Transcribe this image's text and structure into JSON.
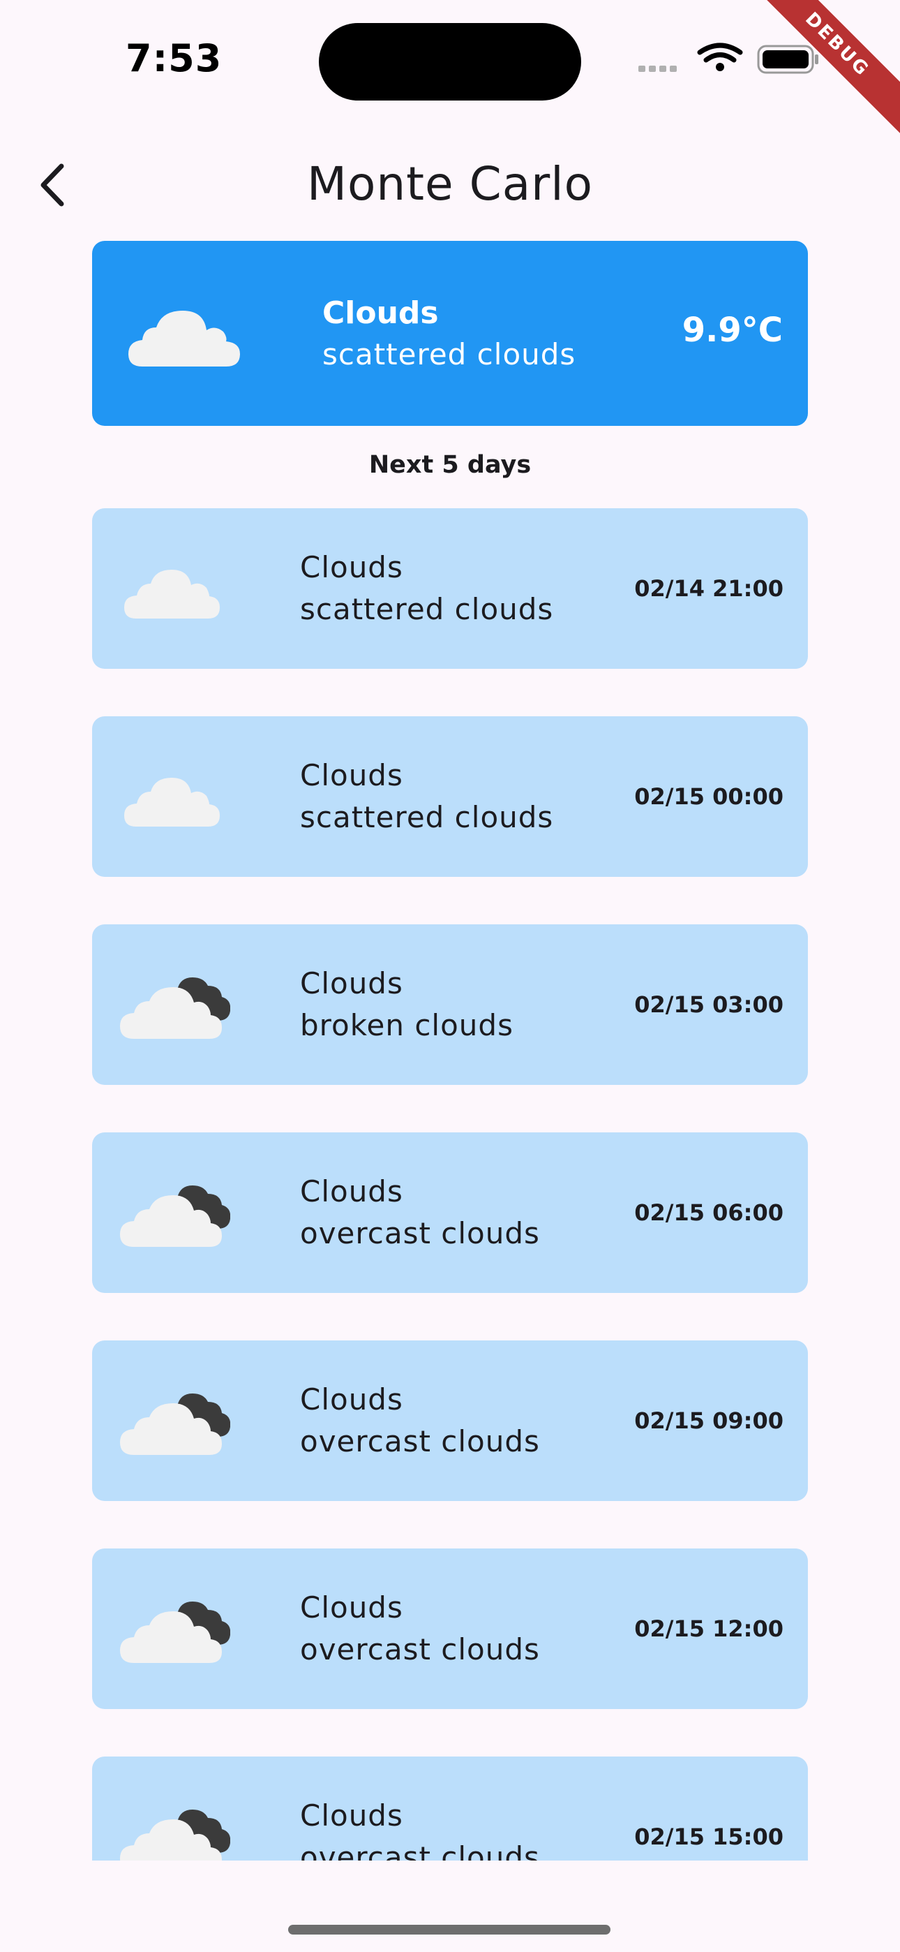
{
  "status_bar": {
    "time": "7:53",
    "debug_label": "DEBUG"
  },
  "app_bar": {
    "title": "Monte Carlo",
    "back_icon": "chevron-left-icon"
  },
  "current": {
    "main": "Clouds",
    "description": "scattered clouds",
    "temperature": "9.9°C",
    "icon": "scattered-clouds-icon",
    "card_color": "#2196f3"
  },
  "section_title": "Next 5 days",
  "forecast": [
    {
      "main": "Clouds",
      "description": "scattered clouds",
      "time": "02/14 21:00",
      "icon": "scattered-clouds-icon"
    },
    {
      "main": "Clouds",
      "description": "scattered clouds",
      "time": "02/15 00:00",
      "icon": "scattered-clouds-icon"
    },
    {
      "main": "Clouds",
      "description": "broken clouds",
      "time": "02/15 03:00",
      "icon": "broken-clouds-icon"
    },
    {
      "main": "Clouds",
      "description": "overcast clouds",
      "time": "02/15 06:00",
      "icon": "broken-clouds-icon"
    },
    {
      "main": "Clouds",
      "description": "overcast clouds",
      "time": "02/15 09:00",
      "icon": "broken-clouds-icon"
    },
    {
      "main": "Clouds",
      "description": "overcast clouds",
      "time": "02/15 12:00",
      "icon": "broken-clouds-icon"
    },
    {
      "main": "Clouds",
      "description": "overcast clouds",
      "time": "02/15 15:00",
      "icon": "broken-clouds-icon"
    }
  ],
  "colors": {
    "forecast_card": "#bbdefb",
    "background": "#fdf7fc"
  }
}
